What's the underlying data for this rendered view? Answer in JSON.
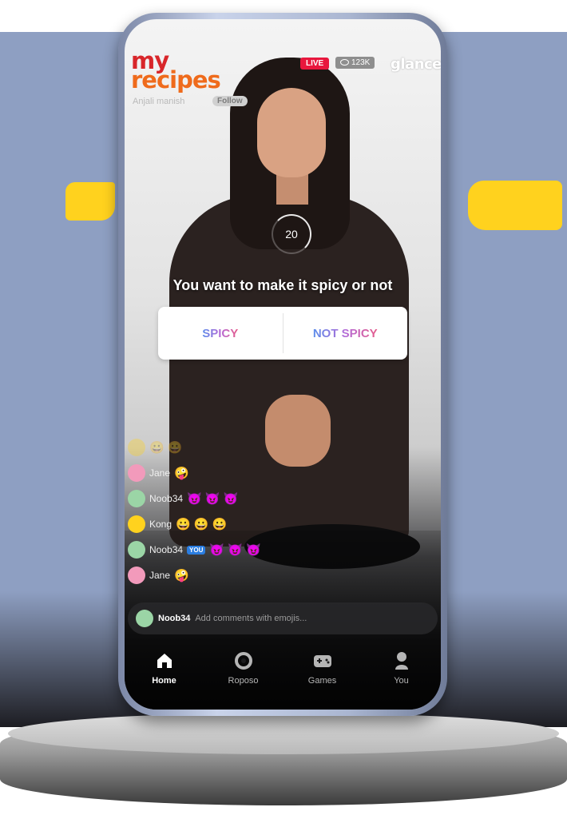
{
  "app": {
    "logo_line1": "my",
    "logo_line2": "recipes",
    "creator_name": "Anjali manish",
    "follow_label": "Follow",
    "live_label": "LIVE",
    "viewer_count": "123K",
    "brand": "glance"
  },
  "poll": {
    "timer": "20",
    "question": "You want to make it spicy or not",
    "option_1": "SPICY",
    "option_2": "NOT SPICY"
  },
  "chat": [
    {
      "user": "Jane",
      "emojis": "🤪",
      "avatar": "pink"
    },
    {
      "user": "Noob34",
      "emojis": "😈 😈 😈",
      "avatar": "green"
    },
    {
      "user": "Kong",
      "emojis": "😀 😀 😀",
      "avatar": "yellow"
    },
    {
      "user": "Noob34",
      "badge": "YOU",
      "emojis": "😈 😈 😈",
      "avatar": "green"
    },
    {
      "user": "Jane",
      "emojis": "🤪",
      "avatar": "pink"
    }
  ],
  "comment": {
    "user": "Noob34",
    "placeholder": "Add comments with emojis..."
  },
  "nav": [
    {
      "label": "Home",
      "icon": "home-icon",
      "active": true
    },
    {
      "label": "Roposo",
      "icon": "roposo-icon"
    },
    {
      "label": "Games",
      "icon": "gamepad-icon"
    },
    {
      "label": "You",
      "icon": "profile-icon"
    }
  ],
  "colors": {
    "background": "#8e9fc2",
    "accent_yellow": "#ffd21e",
    "live_red": "#e8173d",
    "logo_red": "#d8262a",
    "logo_orange": "#ef6b1c"
  }
}
